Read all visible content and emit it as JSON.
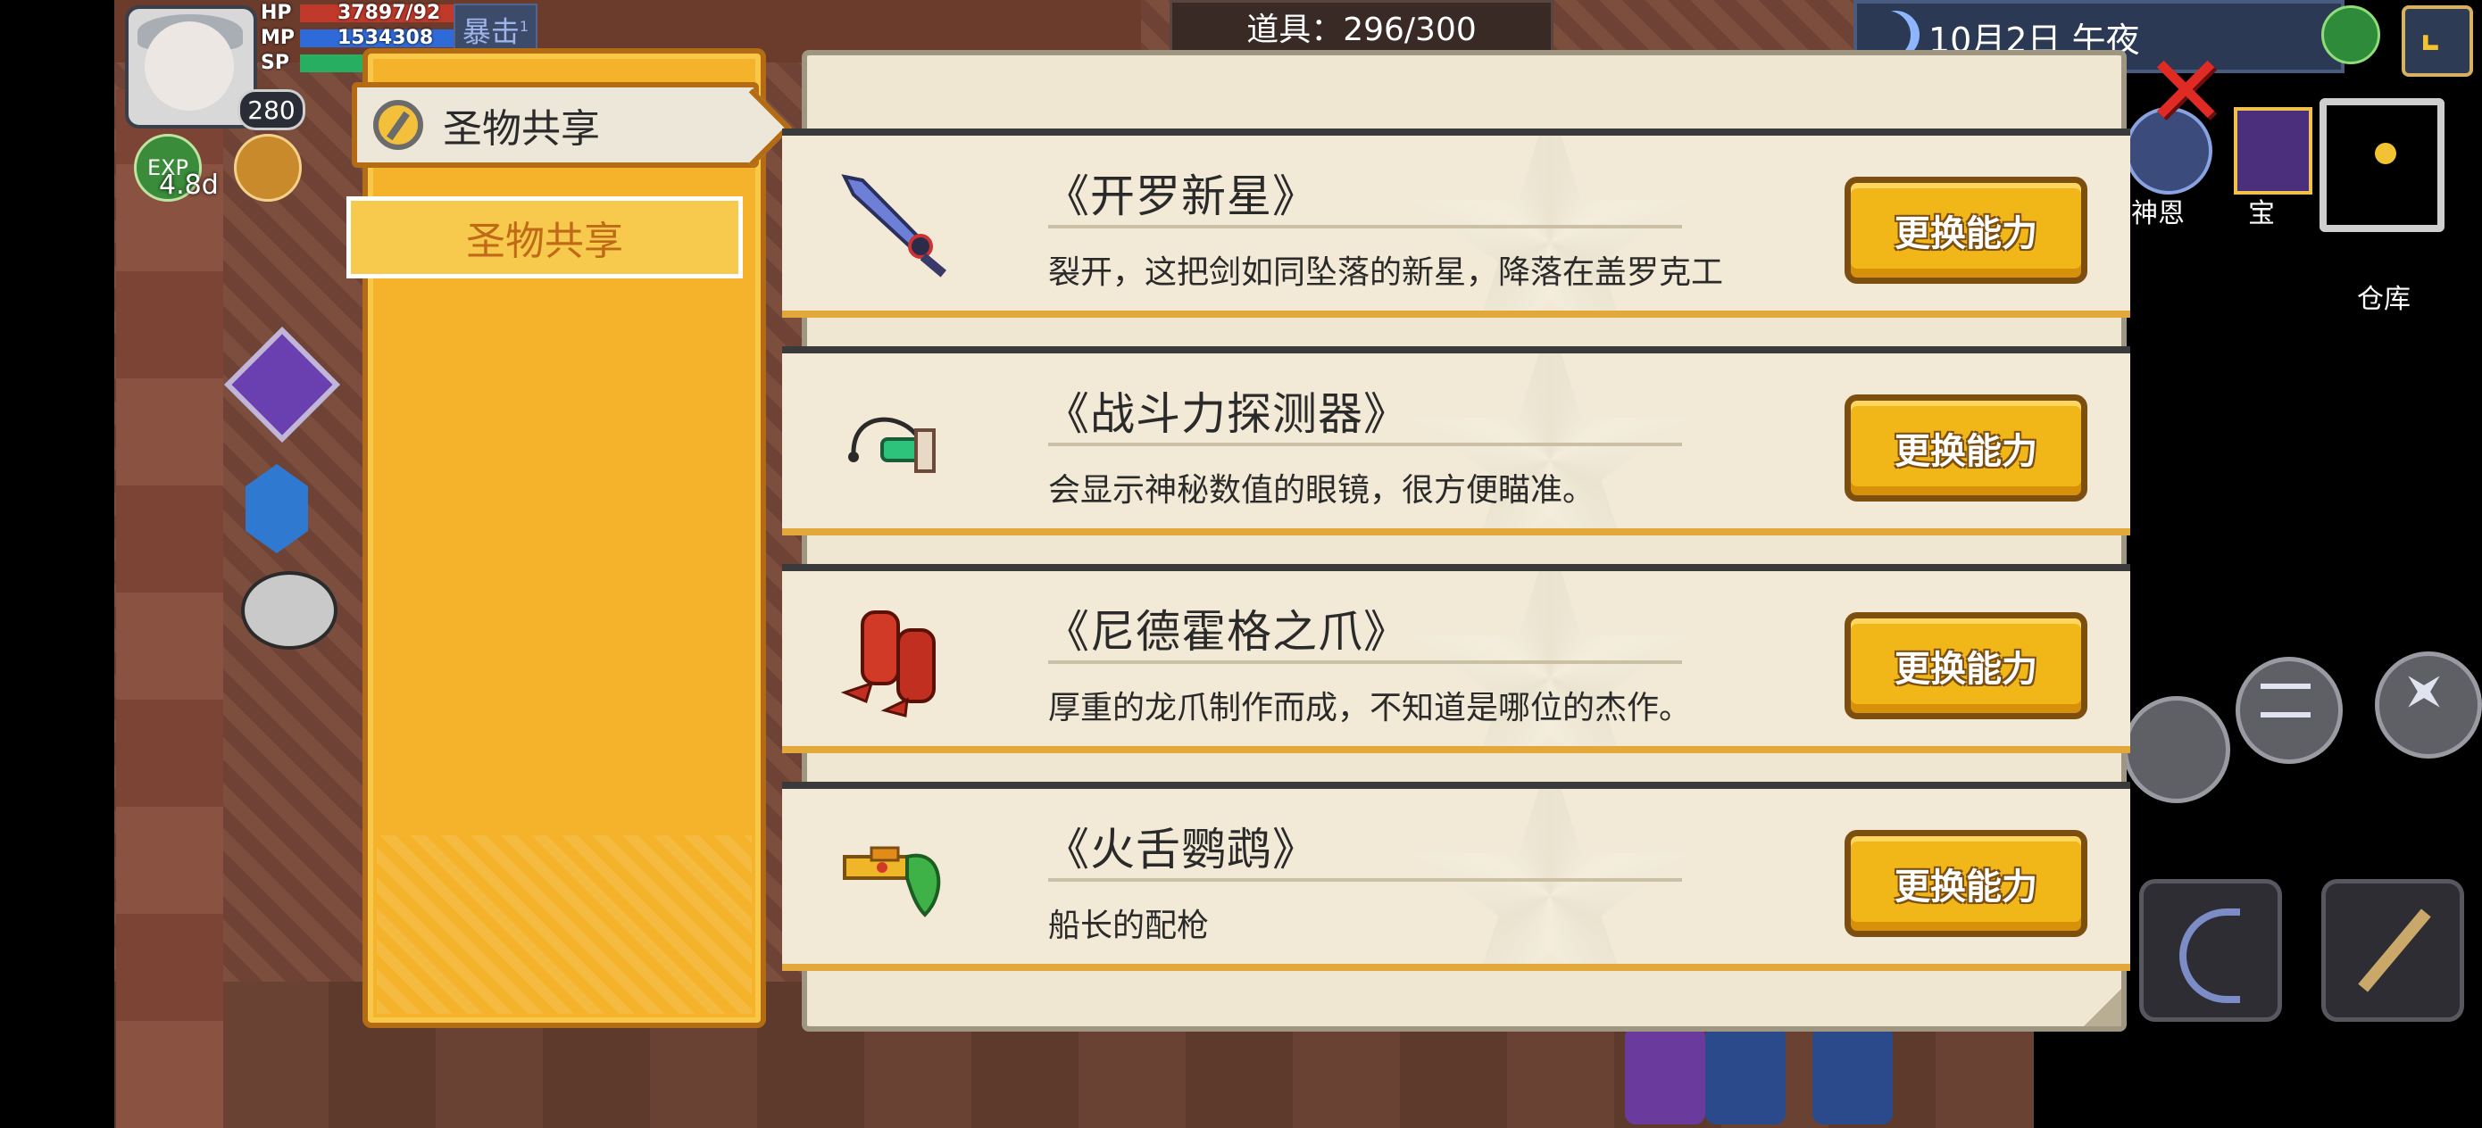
{
  "hud": {
    "hp_label": "HP",
    "hp_value": "37897/92",
    "mp_label": "MP",
    "mp_value": "1534308",
    "sp_label": "SP",
    "level": "280",
    "crit_label": "暴击",
    "crit_sup": "1",
    "exp_label": "EXP",
    "exp_timer": "4.8d",
    "items_counter": "道具：296/300",
    "date": "10月2日  午夜"
  },
  "side": {
    "shen_label": "神恩",
    "bao_label": "宝",
    "warehouse_label": "仓库"
  },
  "menu": {
    "header": "圣物共享",
    "tab": "圣物共享"
  },
  "artifacts": [
    {
      "name": "《开罗新星》",
      "desc": "裂开，这把剑如同坠落的新星，降落在盖罗克工",
      "button": "更换能力",
      "icon": "sword-icon"
    },
    {
      "name": "《战斗力探测器》",
      "desc": "会显示神秘数值的眼镜，很方便瞄准。",
      "button": "更换能力",
      "icon": "scouter-icon"
    },
    {
      "name": "《尼德霍格之爪》",
      "desc": "厚重的龙爪制作而成，不知道是哪位的杰作。",
      "button": "更换能力",
      "icon": "claw-icon"
    },
    {
      "name": "《火舌鹦鹉》",
      "desc": "船长的配枪",
      "button": "更换能力",
      "icon": "pistol-icon"
    }
  ],
  "colors": {
    "panel_gold": "#f4b32a",
    "button_gold": "#f1b718",
    "card_bg": "#f2ead6",
    "close_red": "#e02b24"
  }
}
